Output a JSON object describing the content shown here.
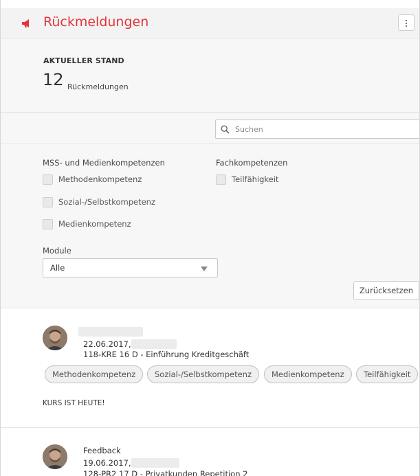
{
  "header": {
    "title": "Rückmeldungen",
    "icon": "megaphone-icon",
    "accent": "#e4343a",
    "menu_icon": "kebab-menu-icon"
  },
  "status": {
    "label": "AKTUELLER STAND",
    "count": "12",
    "unit": "Rückmeldungen"
  },
  "search": {
    "placeholder": "Suchen",
    "value": ""
  },
  "filters": {
    "group1_title": "MSS- und Medienkompetenzen",
    "group1_items": [
      "Methodenkompetenz",
      "Sozial-/Selbstkompetenz",
      "Medienkompetenz"
    ],
    "group2_title": "Fachkompetenzen",
    "group2_items": [
      "Teilfähigkeit"
    ],
    "module_label": "Module",
    "module_value": "Alle",
    "reset_label": "Zurücksetzen"
  },
  "feed": [
    {
      "title": "",
      "date": "22.06.2017,",
      "course": "118-KRE 16 D - Einführung Kreditgeschäft",
      "tags": [
        "Methodenkompetenz",
        "Sozial-/Selbstkompetenz",
        "Medienkompetenz",
        "Teilfähigkeit"
      ],
      "note": "KURS IST HEUTE!"
    },
    {
      "title": "Feedback",
      "date": "19.06.2017,",
      "course": "128-PR2 17 D - Privatkunden Repetition 2"
    }
  ]
}
